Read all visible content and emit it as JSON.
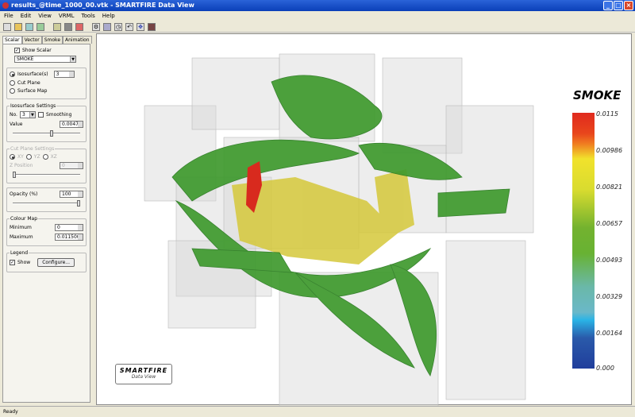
{
  "window": {
    "title": "results_@time_1000_00.vtk - SMARTFIRE Data View",
    "buttons": [
      "_",
      "□",
      "×"
    ]
  },
  "menu": [
    "File",
    "Edit",
    "View",
    "VRML",
    "Tools",
    "Help"
  ],
  "toolbar": [
    "new",
    "open",
    "import",
    "export",
    "copy",
    "print",
    "render",
    "settings",
    "grid",
    "clock",
    "undo",
    "move",
    "snapshot"
  ],
  "tabs": [
    "Scalar",
    "Vector",
    "Smoke",
    "Animation"
  ],
  "scalar": {
    "show_scalar": "Show Scalar",
    "variable": "SMOKE",
    "modes": [
      "Isosurface(s)",
      "Cut Plane",
      "Surface Map"
    ],
    "iso_count_top": "3",
    "iso_settings": {
      "legend": "Isosurface Settings",
      "no_label": "No.",
      "no_value": "3",
      "smoothing": "Smoothing",
      "value_label": "Value",
      "value": "0.0047",
      "slider_pct": 55
    },
    "cut_plane": {
      "legend": "Cut Plane Settings",
      "axes": [
        "XY",
        "YZ",
        "XZ"
      ],
      "position_label": "Z Position",
      "position_value": "0",
      "slider_pct": 0
    },
    "opacity": {
      "label": "Opacity (%)",
      "value": "100",
      "slider_pct": 100
    },
    "colour_map": {
      "legend": "Colour Map",
      "min_label": "Minimum",
      "min_value": "0",
      "max_label": "Maximum",
      "max_value": "0.011500"
    },
    "legend": {
      "legend": "Legend",
      "show": "Show",
      "configure": "Configure..."
    }
  },
  "colorbar": {
    "title": "SMOKE",
    "labels": [
      "0.0115",
      "0.00986",
      "0.00821",
      "0.00657",
      "0.00493",
      "0.00329",
      "0.00164",
      "0.000"
    ]
  },
  "logo": {
    "line1": "SMARTFIRE",
    "line2": "Data View"
  },
  "status": "Ready"
}
